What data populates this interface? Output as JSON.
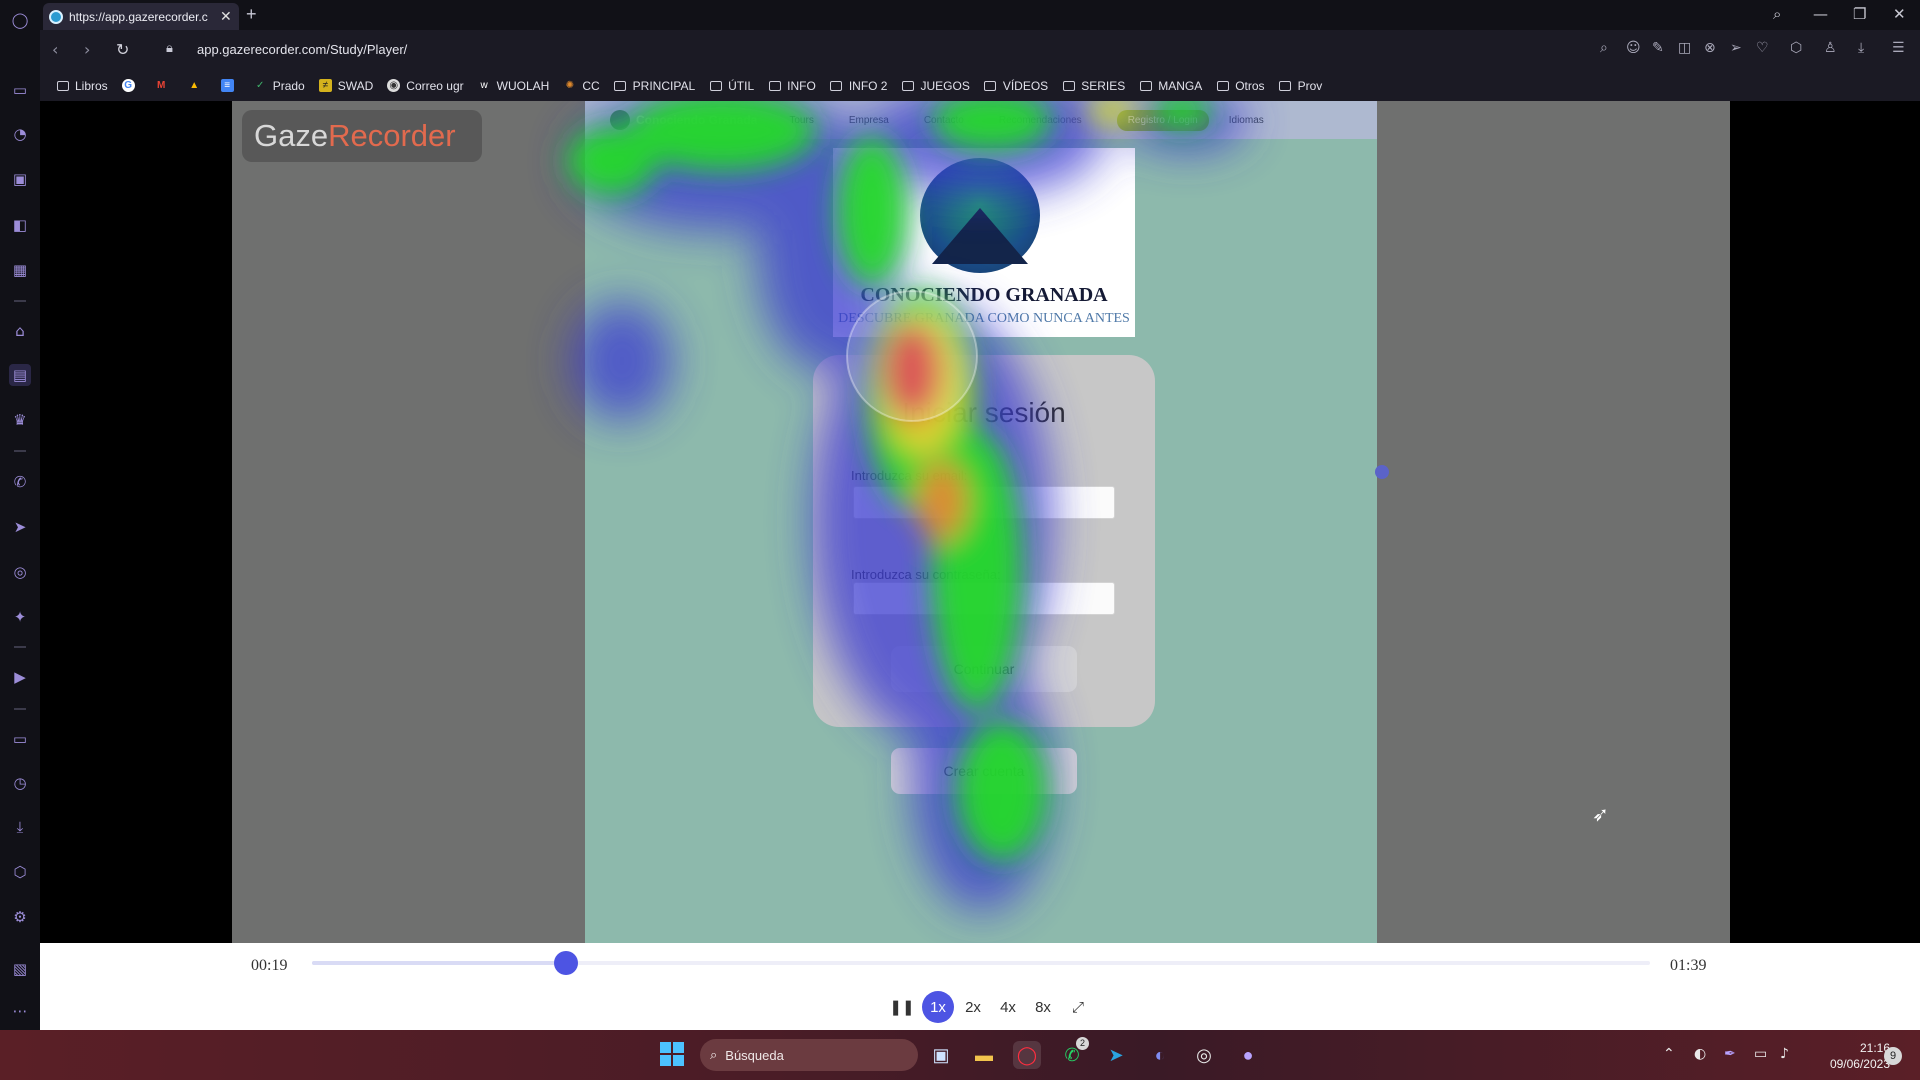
{
  "browser": {
    "tab_title": "https://app.gazerecorder.c",
    "url": "app.gazerecorder.com/Study/Player/",
    "bookmarks": [
      "Libros",
      "Prado",
      "SWAD",
      "Correo ugr",
      "WUOLAH",
      "CC",
      "PRINCIPAL",
      "ÚTIL",
      "INFO",
      "INFO 2",
      "JUEGOS",
      "VÍDEOS",
      "SERIES",
      "MANGA",
      "Otros",
      "Prov"
    ]
  },
  "overlay": {
    "logo_part1": "Gaze",
    "logo_part2": "Recorder"
  },
  "site": {
    "brand": "Conociendo Granada",
    "nav": [
      "Tours",
      "Empresa",
      "Contacto",
      "Recomendaciones"
    ],
    "register": "Registro / Login",
    "languages": "Idiomas",
    "logo_title": "CONOCIENDO GRANADA",
    "logo_subtitle": "DESCUBRE GRANADA COMO NUNCA ANTES",
    "login_title": "Iniciar sesión",
    "email_label": "Introduzca su email:",
    "password_label": "Introduzca su contraseña:",
    "continue_label": "Continuar",
    "create_account_label": "Crear cuenta"
  },
  "player": {
    "current_time": "00:19",
    "total_time": "01:39",
    "progress": 0.19,
    "speeds": [
      "1x",
      "2x",
      "4x",
      "8x"
    ],
    "active_speed": "1x"
  },
  "taskbar": {
    "search_placeholder": "Búsqueda",
    "time": "21:16",
    "date": "09/06/2023",
    "notifications": "9",
    "whatsapp_badge": "2"
  },
  "colors": {
    "accent": "#4d54e3",
    "sidebar_icon": "#9c8dd8"
  }
}
